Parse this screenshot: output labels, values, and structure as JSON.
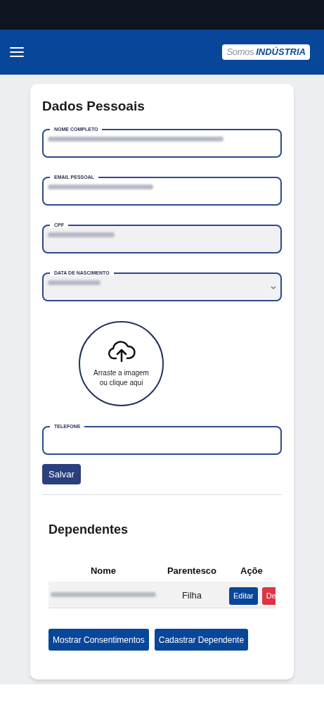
{
  "header": {
    "logo_light": "Somos",
    "logo_bold": "INDÚSTRIA"
  },
  "section_title": "Dados Pessoais",
  "fields": [
    {
      "label": "NOME COMPLETO",
      "kind": "text",
      "value_blurred": true,
      "disabled": false
    },
    {
      "label": "EMAIL PESSOAL",
      "kind": "text",
      "value_blurred": true,
      "disabled": false
    },
    {
      "label": "CPF",
      "kind": "text",
      "value_blurred": true,
      "disabled": true
    },
    {
      "label": "DATA DE NASCIMENTO",
      "kind": "select",
      "value_blurred": true,
      "disabled": true
    }
  ],
  "upload": {
    "text": "Arraste a imagem ou clique aqui"
  },
  "phone_field": {
    "label": "TELEFONE",
    "value_blurred": false,
    "disabled": false
  },
  "save_button": "Salvar",
  "dependents": {
    "title": "Dependentes",
    "columns": [
      "Nome",
      "Parentesco",
      "Açõe"
    ],
    "rows": [
      {
        "name_blurred": true,
        "relation": "Filha",
        "actions": [
          {
            "label": "Editar",
            "kind": "edit"
          },
          {
            "label": "De",
            "kind": "delete"
          }
        ]
      }
    ]
  },
  "buttons": [
    "Mostrar Consentimentos",
    "Cadastrar Dependente"
  ]
}
